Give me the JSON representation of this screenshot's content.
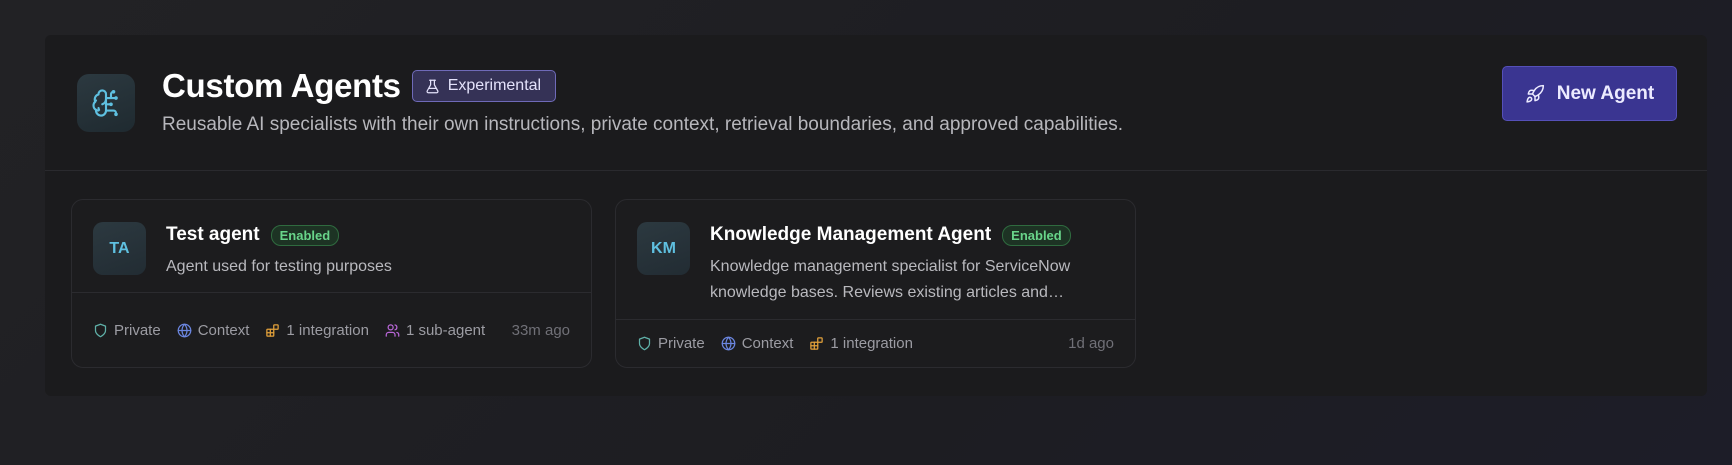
{
  "header": {
    "title": "Custom Agents",
    "badge": "Experimental",
    "subtitle": "Reusable AI specialists with their own instructions, private context, retrieval boundaries, and approved capabilities.",
    "new_agent_label": "New Agent",
    "logo_icon": "brain-icon",
    "badge_icon": "flask-icon",
    "button_icon": "rocket-icon"
  },
  "agents": [
    {
      "initials": "TA",
      "name": "Test agent",
      "status": "Enabled",
      "description": "Agent used for testing purposes",
      "visibility": "Private",
      "context": "Context",
      "integrations": "1 integration",
      "subagents": "1 sub-agent",
      "updated": "33m ago"
    },
    {
      "initials": "KM",
      "name": "Knowledge Management Agent",
      "status": "Enabled",
      "description": "Knowledge management specialist for ServiceNow knowledge bases. Reviews existing articles and…",
      "visibility": "Private",
      "context": "Context",
      "integrations": "1 integration",
      "updated": "1d ago"
    }
  ],
  "colors": {
    "accent": "#3a3591",
    "enabled": "#69d58a",
    "shield": "#5fb0a8",
    "globe": "#6b86e0",
    "integration": "#e2a03a",
    "subagent": "#b967d8"
  }
}
